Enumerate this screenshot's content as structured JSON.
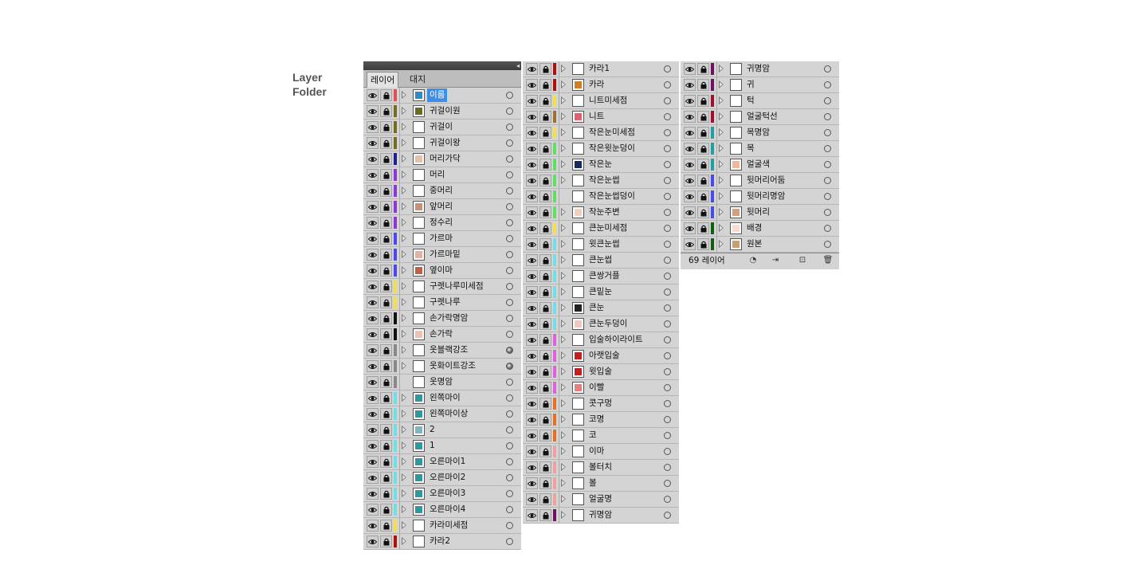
{
  "caption": {
    "line1": "Layer",
    "line2": "Folder"
  },
  "panel": {
    "tabs": [
      {
        "label": "레이어"
      },
      {
        "label": "대지"
      }
    ],
    "footer": {
      "count_label": "69 레이어"
    }
  },
  "icons": {
    "visibility": "eye-icon",
    "lock": "lock-icon",
    "expand": "disclosure-triangle-icon",
    "target": "target-circle-icon",
    "collapse": "collapse-arrows-icon"
  },
  "columns": [
    [
      {
        "name": "이름",
        "color": "#e05050",
        "tri": true,
        "selected": true,
        "thumb": "#2b8cc9",
        "target": "empty"
      },
      {
        "name": "귀걸이원",
        "color": "#6f6f1f",
        "tri": true,
        "thumb": "#6a6a20",
        "target": "empty"
      },
      {
        "name": "귀걸이",
        "color": "#6f6f1f",
        "tri": true,
        "thumb": "",
        "target": "empty"
      },
      {
        "name": "귀걸이왕",
        "color": "#6f6f1f",
        "tri": true,
        "thumb": "",
        "target": "empty"
      },
      {
        "name": "머리가닥",
        "color": "#1f1f8f",
        "tri": true,
        "thumb": "#e8c0a8",
        "target": "empty"
      },
      {
        "name": "머리",
        "color": "#8a3ad4",
        "tri": true,
        "thumb": "",
        "target": "empty"
      },
      {
        "name": "중머리",
        "color": "#8a3ad4",
        "tri": true,
        "thumb": "",
        "target": "empty"
      },
      {
        "name": "앞머리",
        "color": "#8a3ad4",
        "tri": true,
        "thumb": "#c89070",
        "target": "empty"
      },
      {
        "name": "정수리",
        "color": "#8a3ad4",
        "tri": true,
        "thumb": "",
        "target": "empty"
      },
      {
        "name": "가르마",
        "color": "#4a4ae8",
        "tri": true,
        "thumb": "",
        "target": "empty"
      },
      {
        "name": "가르마밑",
        "color": "#4a4ae8",
        "tri": true,
        "thumb": "#e8b0a0",
        "target": "empty"
      },
      {
        "name": "옆이마",
        "color": "#4a4ae8",
        "tri": true,
        "thumb": "#c06040",
        "target": "empty"
      },
      {
        "name": "구렛나루미세점",
        "color": "#f0e050",
        "tri": true,
        "thumb": "",
        "target": "empty"
      },
      {
        "name": "구렛나루",
        "color": "#f0e050",
        "tri": true,
        "thumb": "",
        "target": "empty"
      },
      {
        "name": "손가락명암",
        "color": "#111111",
        "tri": true,
        "thumb": "",
        "target": "empty"
      },
      {
        "name": "손가락",
        "color": "#111111",
        "tri": true,
        "thumb": "#f0c0b0",
        "target": "empty"
      },
      {
        "name": "옷블랙강조",
        "color": "#888888",
        "tri": true,
        "thumb": "",
        "target": "filled"
      },
      {
        "name": "옷화이트강조",
        "color": "#888888",
        "tri": true,
        "thumb": "",
        "target": "filled"
      },
      {
        "name": "옷명암",
        "color": "#888888",
        "tri": false,
        "thumb": "",
        "target": "empty"
      },
      {
        "name": "왼쪽마이",
        "color": "#70e0e8",
        "tri": true,
        "thumb": "#2a9aa0",
        "target": "empty"
      },
      {
        "name": "왼쪽마이상",
        "color": "#70e0e8",
        "tri": true,
        "thumb": "#2a9aa0",
        "target": "empty"
      },
      {
        "name": "2",
        "color": "#70e0e8",
        "tri": true,
        "thumb": "#7ab8c0",
        "target": "empty"
      },
      {
        "name": "1",
        "color": "#70e0e8",
        "tri": true,
        "thumb": "#2a9aa0",
        "target": "empty"
      },
      {
        "name": "오른마이1",
        "color": "#70e0e8",
        "tri": true,
        "thumb": "#2a9aa0",
        "target": "empty"
      },
      {
        "name": "오른마이2",
        "color": "#70e0e8",
        "tri": true,
        "thumb": "#2a9aa0",
        "target": "empty"
      },
      {
        "name": "오른마이3",
        "color": "#70e0e8",
        "tri": true,
        "thumb": "#2a9aa0",
        "target": "empty"
      },
      {
        "name": "오른마이4",
        "color": "#70e0e8",
        "tri": true,
        "thumb": "#2a9aa0",
        "target": "empty"
      },
      {
        "name": "카라미세점",
        "color": "#f0e050",
        "tri": true,
        "thumb": "",
        "target": "empty"
      },
      {
        "name": "카라2",
        "color": "#b01010",
        "tri": true,
        "thumb": "",
        "target": "empty"
      }
    ],
    [
      {
        "name": "카라1",
        "color": "#b01010",
        "tri": true,
        "thumb": "",
        "target": "empty"
      },
      {
        "name": "카라",
        "color": "#b01010",
        "tri": true,
        "thumb": "#d08020",
        "target": "empty"
      },
      {
        "name": "니트미세점",
        "color": "#f0e050",
        "tri": true,
        "thumb": "",
        "target": "empty"
      },
      {
        "name": "니트",
        "color": "#a07030",
        "tri": true,
        "thumb": "#e06070",
        "target": "empty"
      },
      {
        "name": "작은눈미세점",
        "color": "#f0e050",
        "tri": true,
        "thumb": "",
        "target": "empty"
      },
      {
        "name": "작은윗눈덩이",
        "color": "#60e060",
        "tri": true,
        "thumb": "",
        "target": "empty"
      },
      {
        "name": "작은눈",
        "color": "#60e060",
        "tri": true,
        "thumb": "#1a2a5a",
        "target": "empty"
      },
      {
        "name": "작은눈썹",
        "color": "#60e060",
        "tri": true,
        "thumb": "",
        "target": "empty"
      },
      {
        "name": "작은눈썹덩이",
        "color": "#60e060",
        "tri": false,
        "thumb": "",
        "target": "empty"
      },
      {
        "name": "작눈주변",
        "color": "#60e060",
        "tri": true,
        "thumb": "#f0d0c0",
        "target": "empty"
      },
      {
        "name": "큰눈미세점",
        "color": "#f0e050",
        "tri": true,
        "thumb": "",
        "target": "empty"
      },
      {
        "name": "윗큰눈썹",
        "color": "#70e0e8",
        "tri": true,
        "thumb": "",
        "target": "empty"
      },
      {
        "name": "큰눈썹",
        "color": "#70e0e8",
        "tri": true,
        "thumb": "",
        "target": "empty"
      },
      {
        "name": "큰쌍거플",
        "color": "#70e0e8",
        "tri": true,
        "thumb": "",
        "target": "empty"
      },
      {
        "name": "큰밑눈",
        "color": "#70e0e8",
        "tri": true,
        "thumb": "",
        "target": "empty"
      },
      {
        "name": "큰눈",
        "color": "#70e0e8",
        "tri": true,
        "thumb": "#222222",
        "target": "empty"
      },
      {
        "name": "큰눈두덩이",
        "color": "#70e0e8",
        "tri": true,
        "thumb": "#f0c8c0",
        "target": "empty"
      },
      {
        "name": "입술하이라이트",
        "color": "#e060e0",
        "tri": true,
        "thumb": "",
        "target": "empty"
      },
      {
        "name": "아랫입술",
        "color": "#e060e0",
        "tri": true,
        "thumb": "#c02020",
        "target": "empty"
      },
      {
        "name": "윗입술",
        "color": "#e060e0",
        "tri": true,
        "thumb": "#c02020",
        "target": "empty"
      },
      {
        "name": "이빨",
        "color": "#e060e0",
        "tri": true,
        "thumb": "#e08080",
        "target": "empty"
      },
      {
        "name": "콧구멍",
        "color": "#e87020",
        "tri": true,
        "thumb": "",
        "target": "empty"
      },
      {
        "name": "코명",
        "color": "#e87020",
        "tri": true,
        "thumb": "",
        "target": "empty"
      },
      {
        "name": "코",
        "color": "#e87020",
        "tri": true,
        "thumb": "",
        "target": "empty"
      },
      {
        "name": "이마",
        "color": "#f0a0a0",
        "tri": true,
        "thumb": "",
        "target": "empty"
      },
      {
        "name": "볼터치",
        "color": "#f0a0a0",
        "tri": true,
        "thumb": "",
        "target": "empty"
      },
      {
        "name": "볼",
        "color": "#f0a0a0",
        "tri": true,
        "thumb": "",
        "target": "empty"
      },
      {
        "name": "얼굴명",
        "color": "#f0a0a0",
        "tri": true,
        "thumb": "",
        "target": "empty"
      },
      {
        "name": "귀명암",
        "color": "#701060",
        "tri": true,
        "thumb": "",
        "target": "empty"
      }
    ],
    [
      {
        "name": "귀명암",
        "color": "#701060",
        "tri": true,
        "thumb": "",
        "target": "empty"
      },
      {
        "name": "귀",
        "color": "#701060",
        "tri": true,
        "thumb": "",
        "target": "empty"
      },
      {
        "name": "턱",
        "color": "#a01030",
        "tri": true,
        "thumb": "",
        "target": "empty"
      },
      {
        "name": "얼굴턱선",
        "color": "#a01030",
        "tri": true,
        "thumb": "",
        "target": "empty"
      },
      {
        "name": "목명암",
        "color": "#20a0a0",
        "tri": true,
        "thumb": "",
        "target": "empty"
      },
      {
        "name": "목",
        "color": "#20a0a0",
        "tri": true,
        "thumb": "",
        "target": "empty"
      },
      {
        "name": "얼굴색",
        "color": "#20a0a0",
        "tri": true,
        "thumb": "#f0b898",
        "target": "empty"
      },
      {
        "name": "뒷머리어둠",
        "color": "#4a4ae8",
        "tri": true,
        "thumb": "",
        "target": "empty"
      },
      {
        "name": "뒷머리명암",
        "color": "#4a4ae8",
        "tri": true,
        "thumb": "",
        "target": "empty"
      },
      {
        "name": "뒷머리",
        "color": "#4a4ae8",
        "tri": true,
        "thumb": "#d0a080",
        "target": "empty"
      },
      {
        "name": "배경",
        "color": "#106010",
        "tri": true,
        "thumb": "#f8dcd0",
        "target": "empty"
      },
      {
        "name": "원본",
        "color": "#106010",
        "tri": true,
        "thumb": "#c8a070",
        "target": "empty",
        "lock_alt": true
      }
    ]
  ]
}
